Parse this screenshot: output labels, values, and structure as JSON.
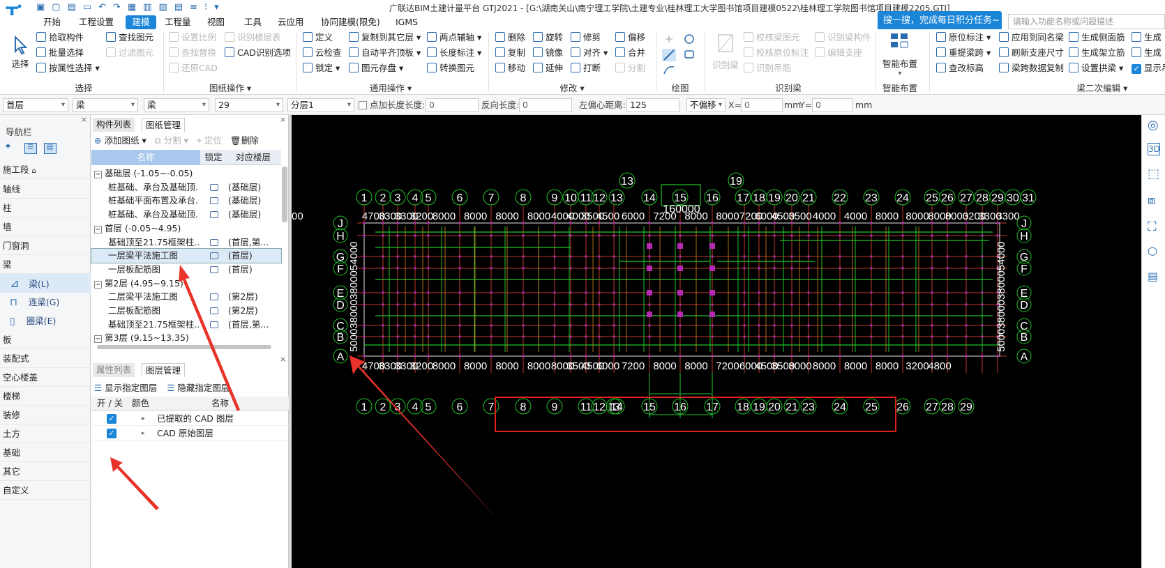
{
  "titlebar": {
    "title": "广联达BIM土建计量平台 GTJ2021 - [G:\\湖南关山\\南宁理工学院\\土建专业\\桂林理工大学图书馆项目建模0522\\桂林理工学院图书馆项目建模2205.GTJ]"
  },
  "tabs": [
    "开始",
    "工程设置",
    "建模",
    "工程量",
    "视图",
    "工具",
    "云应用",
    "协同建模(限免)",
    "IGMS"
  ],
  "active_tab": "建模",
  "search": {
    "tip": "搜一搜，完成每日积分任务~",
    "placeholder": "请输入功能名称或问题描述"
  },
  "ribbon": {
    "select": {
      "big": "选择",
      "items": [
        "拾取构件",
        "批量选择",
        "按属性选择",
        "查找图元",
        "过滤图元"
      ],
      "group": "选择"
    },
    "drawing": {
      "items": [
        "设置比例",
        "查找替换",
        "还原CAD",
        "识别楼层表",
        "CAD识别选项"
      ],
      "group": "图纸操作"
    },
    "general": {
      "items": [
        "定义",
        "云检查",
        "锁定",
        "复制到其它层",
        "自动平齐顶板",
        "图元存盘",
        "两点辅轴",
        "长度标注",
        "转换图元"
      ],
      "group": "通用操作"
    },
    "modify": {
      "items": [
        "删除",
        "旋转",
        "修剪",
        "偏移",
        "复制",
        "镜像",
        "对齐",
        "合并",
        "移动",
        "延伸",
        "打断",
        "分割"
      ],
      "group": "修改"
    },
    "draw": {
      "group": "绘图"
    },
    "recognize": {
      "big": "识别梁",
      "items": [
        "校核梁图元",
        "校核原位标注",
        "识别吊筋",
        "识别梁构件",
        "编辑支座"
      ],
      "group": "识别梁"
    },
    "smart": {
      "big": "智能布置",
      "group": "智能布置"
    },
    "beam2": {
      "items": [
        "原位标注",
        "应用到同名梁",
        "生成侧面筋",
        "生成",
        "重提梁跨",
        "刷新支座尺寸",
        "生成架立筋",
        "生成",
        "查改标高",
        "梁跨数据复制",
        "设置拱梁",
        "显示吊"
      ],
      "group": "梁二次编辑"
    }
  },
  "propbar": {
    "floor": "首层",
    "type1": "梁",
    "type2": "梁",
    "code": "29",
    "layer": "分层1",
    "point_len": "点加长度",
    "len_label": "长度:",
    "len_val": "0",
    "rev_label": "反向长度:",
    "rev_val": "0",
    "offset_label": "左偏心距离:",
    "offset_val": "125",
    "nooffset": "不偏移",
    "x_label": "X=",
    "x_val": "0",
    "mm1": "mm",
    "y_label": "Y=",
    "y_val": "0",
    "mm2": "mm"
  },
  "nav": {
    "title": "导航栏",
    "items": [
      "施工段",
      "轴线",
      "柱",
      "墙",
      "门窗洞",
      "梁",
      "板",
      "装配式",
      "空心楼盖",
      "楼梯",
      "装修",
      "土方",
      "基础",
      "其它",
      "自定义"
    ],
    "sub": [
      "梁(L)",
      "连梁(G)",
      "圈梁(E)"
    ]
  },
  "panel": {
    "tabs_top": [
      "构件列表",
      "图纸管理"
    ],
    "toolbar": [
      "添加图纸",
      "分割",
      "定位",
      "删除"
    ],
    "headers": [
      "名称",
      "锁定",
      "对应楼层"
    ],
    "rows": [
      {
        "group": true,
        "name": "基础层 (-1.05~-0.05)"
      },
      {
        "name": "桩基础、承台及基础顶...",
        "floor": "(基础层)"
      },
      {
        "name": "桩基础平面布置及承台...",
        "floor": "(基础层)"
      },
      {
        "name": "桩基础、承台及基础顶...",
        "floor": "(基础层)"
      },
      {
        "group": true,
        "name": "首层 (-0.05~4.95)"
      },
      {
        "name": "基础顶至21.75框架柱...",
        "floor": "(首层,第..."
      },
      {
        "name": "一层梁平法施工图",
        "floor": "(首层)",
        "selected": true
      },
      {
        "name": "一层板配筋图",
        "floor": "(首层)"
      },
      {
        "group": true,
        "name": "第2层 (4.95~9.15)"
      },
      {
        "name": "二层梁平法施工图",
        "floor": "(第2层)"
      },
      {
        "name": "二层板配筋图",
        "floor": "(第2层)"
      },
      {
        "name": "基础顶至21.75框架柱...",
        "floor": "(首层,第..."
      },
      {
        "group": true,
        "name": "第3层 (9.15~13.35)"
      }
    ],
    "tabs_bottom": [
      "属性列表",
      "图层管理"
    ],
    "layer_toolbar": [
      "显示指定图层",
      "隐藏指定图层"
    ],
    "layer_headers": [
      "开 / 关",
      "颜色",
      "名称"
    ],
    "layers": [
      "已提取的 CAD 图层",
      "CAD 原始图层"
    ]
  },
  "cad": {
    "top_axes": [
      "1",
      "2",
      "3",
      "4",
      "5",
      "6",
      "7",
      "8",
      "9",
      "10",
      "11",
      "12",
      "13",
      "14",
      "15",
      "16",
      "17",
      "18",
      "19",
      "20",
      "21",
      "22",
      "23",
      "24",
      "25",
      "26",
      "27",
      "28",
      "29",
      "30",
      "31"
    ],
    "upper_dims": [
      "4700",
      "3300",
      "3300",
      "3200",
      "8000",
      "8000",
      "8000",
      "8000",
      "4000",
      "4000",
      "3500",
      "4500",
      "6000",
      "7200",
      "8000",
      "8000",
      "7200",
      "6000",
      "4500",
      "3500",
      "4000",
      "4000",
      "8000",
      "8000",
      "8000",
      "8000",
      "3200",
      "3300",
      "3300",
      "4700"
    ],
    "bottom_axes": [
      "1",
      "2",
      "3",
      "4",
      "5",
      "6",
      "7",
      "8",
      "9",
      "11",
      "12",
      "13",
      "14",
      "15",
      "16",
      "17",
      "18",
      "19",
      "20",
      "21",
      "23",
      "24",
      "25",
      "26",
      "27",
      "28",
      "29"
    ],
    "side_axes": [
      "J",
      "H",
      "G",
      "F",
      "E",
      "D",
      "C",
      "B",
      "A"
    ],
    "extra_labels": [
      "13",
      "19",
      "160000"
    ],
    "bottom_dims": [
      "4700",
      "3300",
      "3300",
      "3200",
      "8000",
      "8000",
      "8000",
      "8000",
      "8000",
      "3500",
      "4500",
      "6000",
      "7200",
      "8000",
      "8000",
      "7200",
      "6000",
      "4500",
      "3500",
      "8000",
      "8000",
      "8000",
      "8000",
      "3200",
      "4800"
    ]
  }
}
